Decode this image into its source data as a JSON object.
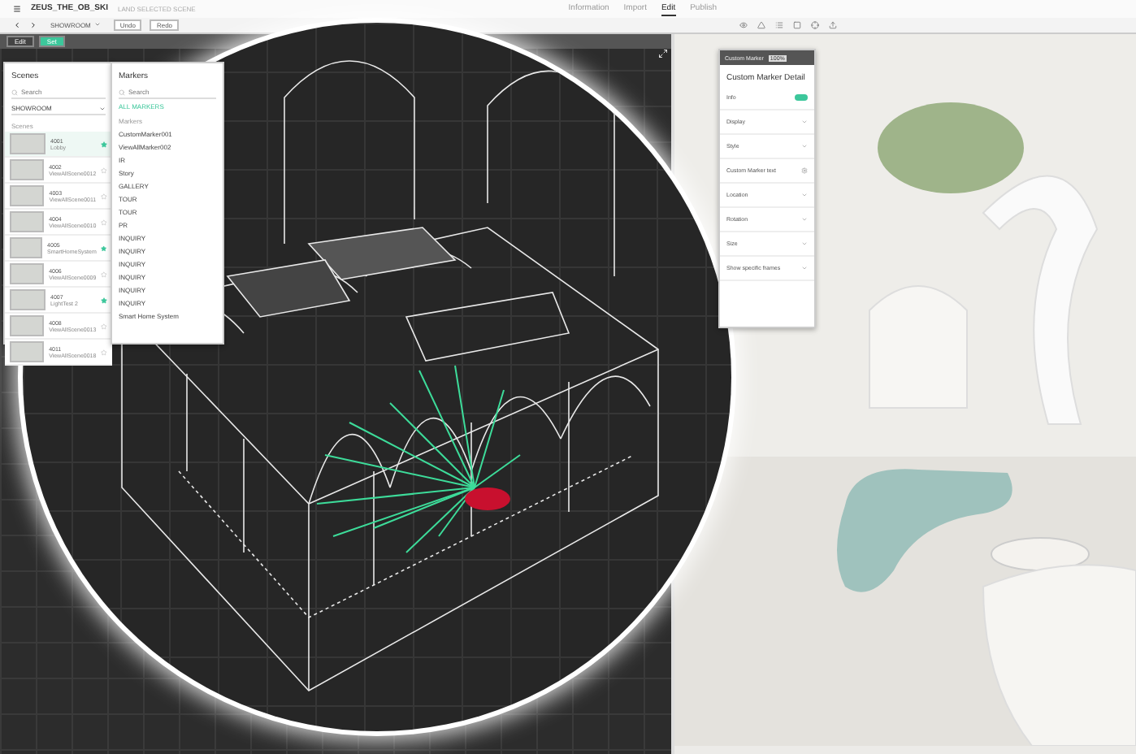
{
  "app": {
    "title": "ZEUS_THE_OB_SKI",
    "subtitle": "LAND SELECTED SCENE"
  },
  "nav_tabs": [
    {
      "label": "Information",
      "selected": false
    },
    {
      "label": "Import",
      "selected": false
    },
    {
      "label": "Edit",
      "selected": true
    },
    {
      "label": "Publish",
      "selected": false
    }
  ],
  "toolbar": {
    "scene_dropdown": "SHOWROOM",
    "buttons": [
      "Undo",
      "Redo"
    ]
  },
  "viewport_toolbar": {
    "modes": [
      {
        "label": "Edit",
        "selected": false
      },
      {
        "label": "Set",
        "selected": true
      }
    ]
  },
  "scenes_panel": {
    "title": "Scenes",
    "search_placeholder": "Search",
    "dropdown": "SHOWROOM",
    "section": "Scenes",
    "items": [
      {
        "code": "4001",
        "name": "Lobby",
        "starred": true,
        "selected": true
      },
      {
        "code": "4002",
        "name": "ViewAllScene0012",
        "starred": false,
        "selected": false
      },
      {
        "code": "4003",
        "name": "ViewAllScene0011",
        "starred": false,
        "selected": false
      },
      {
        "code": "4004",
        "name": "ViewAllScene0010",
        "starred": false,
        "selected": false
      },
      {
        "code": "4005",
        "name": "SmartHomeSystem",
        "starred": true,
        "selected": false
      },
      {
        "code": "4006",
        "name": "ViewAllScene0009",
        "starred": false,
        "selected": false
      },
      {
        "code": "4007",
        "name": "LightTest 2",
        "starred": true,
        "selected": false
      },
      {
        "code": "4008",
        "name": "ViewAllScene0013",
        "starred": false,
        "selected": false
      },
      {
        "code": "4011",
        "name": "ViewAllScene0018",
        "starred": false,
        "selected": false
      }
    ]
  },
  "markers_panel": {
    "title": "Markers",
    "search_placeholder": "Search",
    "filter": "ALL MARKERS",
    "section": "Markers",
    "items": [
      "CustomMarker001",
      "ViewAllMarker002",
      "IR",
      "Story",
      "GALLERY",
      "TOUR",
      "TOUR",
      "PR",
      "INQUIRY",
      "INQUIRY",
      "INQUIRY",
      "INQUIRY",
      "INQUIRY",
      "INQUIRY",
      "Smart Home System"
    ]
  },
  "detail_panel": {
    "tab": "Custom Marker",
    "zoom": "100%",
    "title": "Custom Marker Detail",
    "rows": [
      {
        "kind": "toggle",
        "label": "Info",
        "on": true
      },
      {
        "kind": "section",
        "label": "Display"
      },
      {
        "kind": "section",
        "label": "Style"
      },
      {
        "kind": "field",
        "label": "Custom Marker text"
      },
      {
        "kind": "section",
        "label": "Location"
      },
      {
        "kind": "section",
        "label": "Rotation"
      },
      {
        "kind": "section",
        "label": "Size"
      },
      {
        "kind": "section",
        "label": "Show specific frames"
      }
    ]
  }
}
